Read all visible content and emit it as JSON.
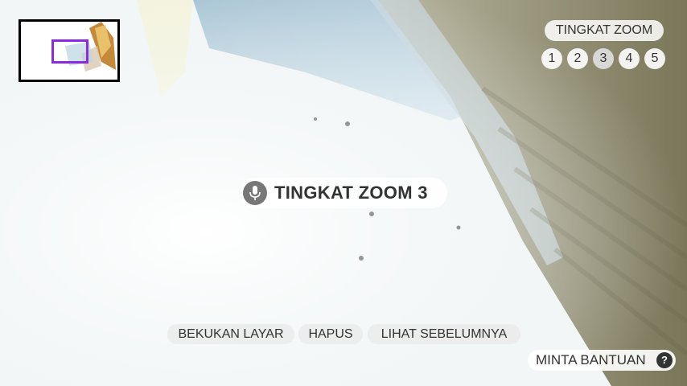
{
  "zoom_panel": {
    "title": "TINGKAT ZOOM",
    "levels": [
      "1",
      "2",
      "3",
      "4",
      "5"
    ],
    "active_level": "3"
  },
  "voice_feedback": {
    "icon": "microphone-icon",
    "text": "TINGKAT ZOOM 3"
  },
  "commands": {
    "freeze": "BEKUKAN LAYAR",
    "clear": "HAPUS",
    "previous": "LIHAT SEBELUMNYA"
  },
  "help": {
    "label": "MINTA BANTUAN",
    "icon_text": "?"
  },
  "colors": {
    "minimap_border": "#000000",
    "minimap_viewport": "#8a2be2",
    "pill_background": "#ffffff",
    "text": "#333333",
    "mic_icon_bg": "#777777"
  }
}
